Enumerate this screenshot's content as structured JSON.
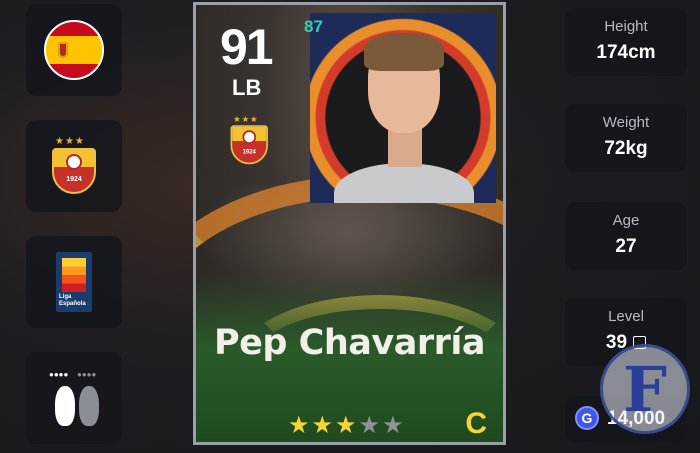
{
  "player": {
    "rating": "91",
    "position": "LB",
    "stat_badge": "87",
    "name": "Pep Chavarría",
    "stars_filled": 3,
    "stars_total": 5,
    "grade": "C"
  },
  "club": {
    "year": "1924"
  },
  "league": {
    "logo_text": "Liga Española"
  },
  "stats": {
    "height": {
      "label": "Height",
      "value": "174cm"
    },
    "weight": {
      "label": "Weight",
      "value": "72kg"
    },
    "age": {
      "label": "Age",
      "value": "27"
    },
    "level": {
      "label": "Level",
      "value": "39"
    }
  },
  "currency": {
    "icon_letter": "G",
    "amount": "14,000"
  },
  "watermark": {
    "letter": "F"
  },
  "icons": [
    "spain-flag-icon",
    "club-badge-icon",
    "league-logo-icon",
    "footedness-icon",
    "edit-icon",
    "gold-coin-icon"
  ]
}
